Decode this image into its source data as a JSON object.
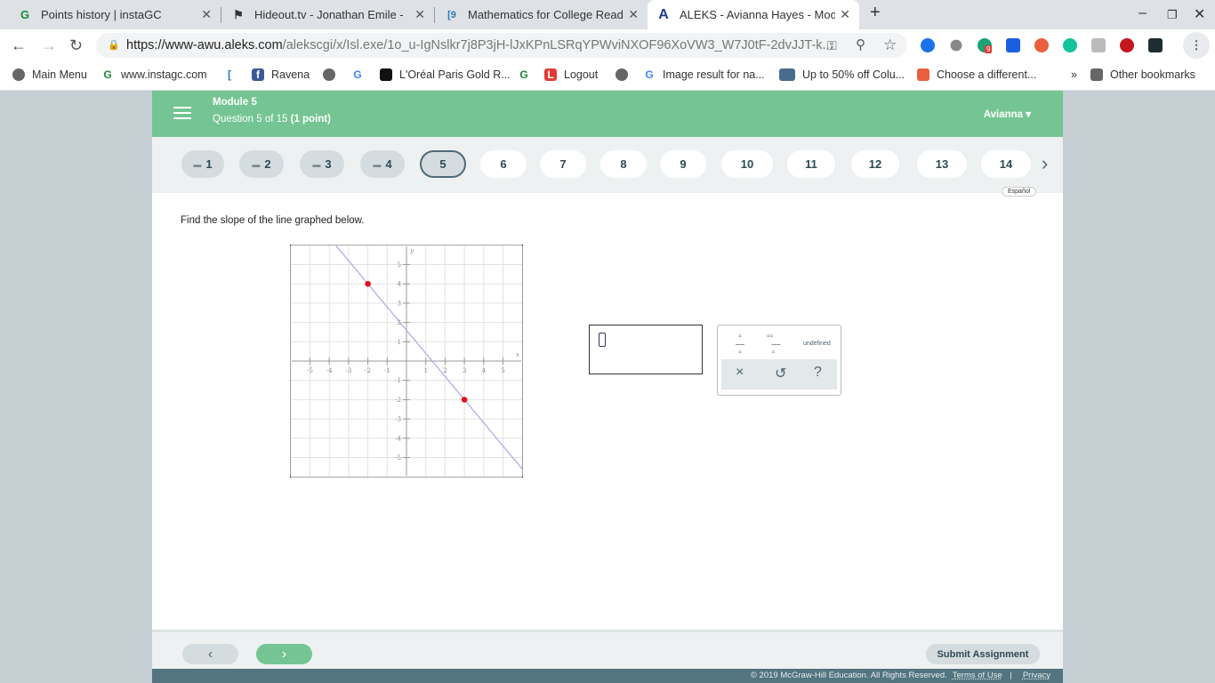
{
  "browser": {
    "tabs": [
      {
        "title": "Points history | instaGC",
        "icon": "G"
      },
      {
        "title": "Hideout.tv - Jonathan Emile - Ed",
        "icon": "⚑"
      },
      {
        "title": "Mathematics for College Readin",
        "icon": "[9"
      },
      {
        "title": "ALEKS - Avianna Hayes - Module",
        "icon": "A"
      }
    ],
    "url_host": "https://www-awu.aleks.com",
    "url_path": "/alekscgi/x/Isl.exe/1o_u-IgNslkr7j8P3jH-lJxKPnLSRqYPWviNXOF96XoVW3_W7J0tF-2dvJJT-k...",
    "ext_badge": "9",
    "bookmarks": [
      "Main Menu",
      "www.instagc.com",
      "Ravena",
      "L'Oréal Paris Gold R...",
      "Logout",
      "Image result for na...",
      "Up to 50% off Colu...",
      "Choose a different..."
    ],
    "other_bookmarks": "Other bookmarks"
  },
  "header": {
    "module": "Module 5",
    "question": "Question 5 of 15",
    "points": "(1 point)",
    "user": "Avianna"
  },
  "questions": [
    "1",
    "2",
    "3",
    "4",
    "5",
    "6",
    "7",
    "8",
    "9",
    "10",
    "11",
    "12",
    "13",
    "14"
  ],
  "current_question": 5,
  "espanol": "Español",
  "prompt": "Find the slope of the line graphed below.",
  "chart_data": {
    "type": "line",
    "xlabel": "x",
    "ylabel": "y",
    "xlim": [
      -6,
      6
    ],
    "ylim": [
      -6,
      6
    ],
    "x_ticks": [
      -5,
      -4,
      -3,
      -2,
      -1,
      1,
      2,
      3,
      4,
      5
    ],
    "y_ticks": [
      -5,
      -4,
      -3,
      -2,
      -1,
      1,
      2,
      3,
      4,
      5
    ],
    "grid": true,
    "points": [
      {
        "x": -2,
        "y": 4
      },
      {
        "x": 3,
        "y": -2
      }
    ],
    "line_color": "#a9a9e6",
    "point_color": "#e8101b"
  },
  "palette": {
    "undefined_label": "undefined",
    "clear": "×",
    "undo": "↺",
    "help": "?"
  },
  "footer": {
    "submit": "Submit Assignment",
    "copyright": "© 2019 McGraw-Hill Education. All Rights Reserved.",
    "terms": "Terms of Use",
    "sep": "|",
    "privacy": "Privacy"
  }
}
